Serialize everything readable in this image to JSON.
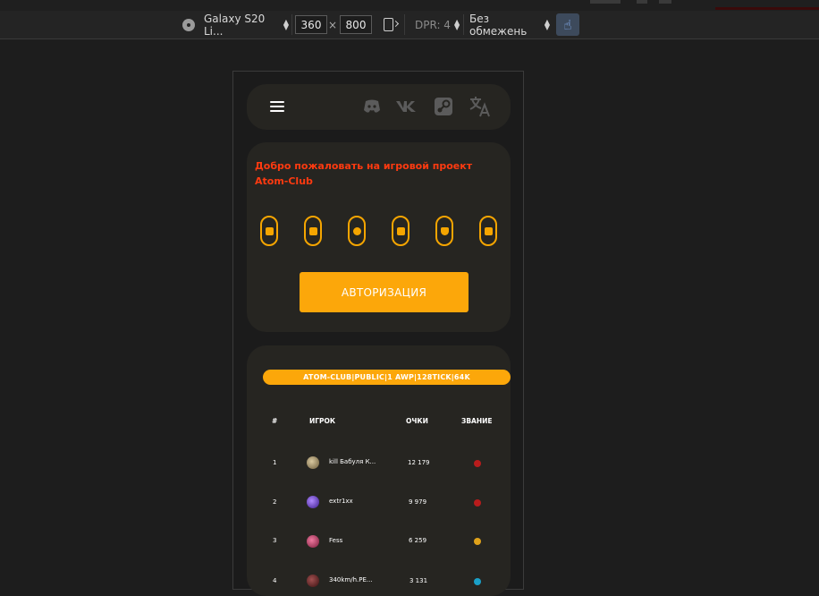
{
  "devtools": {
    "device_name": "Galaxy S20 Li...",
    "width": "360",
    "height": "800",
    "times": "×",
    "dpr": "DPR: 4",
    "throttle": "Без обмежень"
  },
  "site": {
    "welcome_text": "Добро пожаловать на игровой проект Atom-Club",
    "auth_button": "АВТОРИЗАЦИЯ",
    "server_name": "ATOM-CLUB|PUBLIC|1 AWP|128TICK|64K",
    "table": {
      "headers": [
        "#",
        "ИГРОК",
        "ОЧКИ",
        "ЗВАНИЕ"
      ],
      "rows": [
        {
          "pos": "1",
          "player": "kill Бабуля К...",
          "points": "12 179"
        },
        {
          "pos": "2",
          "player": "extr1xx",
          "points": "9 979"
        },
        {
          "pos": "3",
          "player": "Fess",
          "points": "6 259"
        },
        {
          "pos": "4",
          "player": "340km/h.PE...",
          "points": "3 131"
        }
      ]
    }
  },
  "colors": {
    "accent": "#fca70a",
    "welcome_text": "#ff3a10",
    "card_bg": "#262521",
    "page_bg": "#1d1d1d"
  },
  "icons": [
    "chrome-icon",
    "rotate-icon",
    "touch-icon",
    "menu-icon",
    "discord-icon",
    "vk-icon",
    "steam-icon",
    "translate-icon",
    "chat-icon",
    "cart-icon",
    "user-icon",
    "stats-icon",
    "shield-icon",
    "id-card-icon"
  ]
}
